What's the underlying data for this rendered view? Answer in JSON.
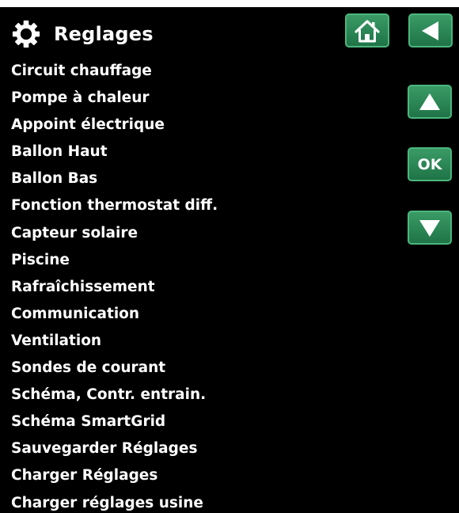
{
  "header": {
    "title": "Reglages",
    "icon": "gear-icon"
  },
  "nav": {
    "home_icon": "home-icon",
    "back_icon": "back-arrow-icon",
    "up_icon": "arrow-up-icon",
    "ok_label": "OK",
    "down_icon": "arrow-down-icon",
    "button_color": "#2e8b57"
  },
  "menu": {
    "items": [
      {
        "label": "Circuit chauffage"
      },
      {
        "label": "Pompe à chaleur"
      },
      {
        "label": "Appoint électrique"
      },
      {
        "label": "Ballon Haut"
      },
      {
        "label": "Ballon Bas"
      },
      {
        "label": "Fonction thermostat diff."
      },
      {
        "label": "Capteur solaire"
      },
      {
        "label": "Piscine"
      },
      {
        "label": "Rafraîchissement"
      },
      {
        "label": "Communication"
      },
      {
        "label": "Ventilation"
      },
      {
        "label": "Sondes de courant"
      },
      {
        "label": "Schéma, Contr. entrain."
      },
      {
        "label": "Schéma SmartGrid"
      },
      {
        "label": "Sauvegarder Réglages"
      },
      {
        "label": "Charger Réglages"
      },
      {
        "label": "Charger réglages usine"
      }
    ]
  }
}
